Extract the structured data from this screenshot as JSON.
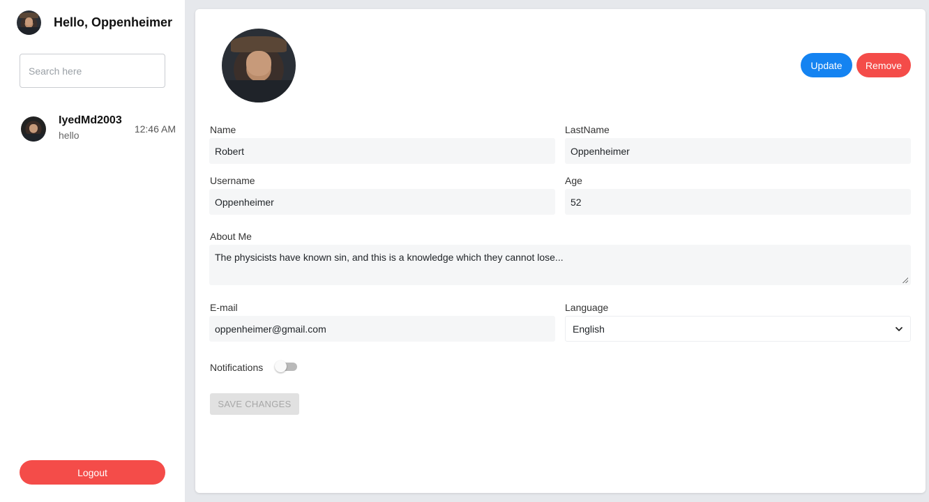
{
  "sidebar": {
    "greeting": "Hello, Oppenheimer",
    "search_placeholder": "Search here",
    "chats": [
      {
        "name": "IyedMd2003",
        "last_message": "hello",
        "time": "12:46 AM"
      }
    ],
    "logout_label": "Logout"
  },
  "profile": {
    "update_label": "Update",
    "remove_label": "Remove",
    "fields": {
      "name_label": "Name",
      "name_value": "Robert",
      "lastname_label": "LastName",
      "lastname_value": "Oppenheimer",
      "username_label": "Username",
      "username_value": "Oppenheimer",
      "age_label": "Age",
      "age_value": "52",
      "about_label": "About Me",
      "about_value": "The physicists have known sin, and this is a knowledge which they cannot lose...",
      "email_label": "E-mail",
      "email_value": "oppenheimer@gmail.com",
      "language_label": "Language",
      "language_value": "English"
    },
    "notifications_label": "Notifications",
    "notifications_enabled": false,
    "save_label": "SAVE CHANGES"
  },
  "colors": {
    "primary": "#1483f1",
    "danger": "#f44c49",
    "page_bg": "#e6e8ec"
  }
}
